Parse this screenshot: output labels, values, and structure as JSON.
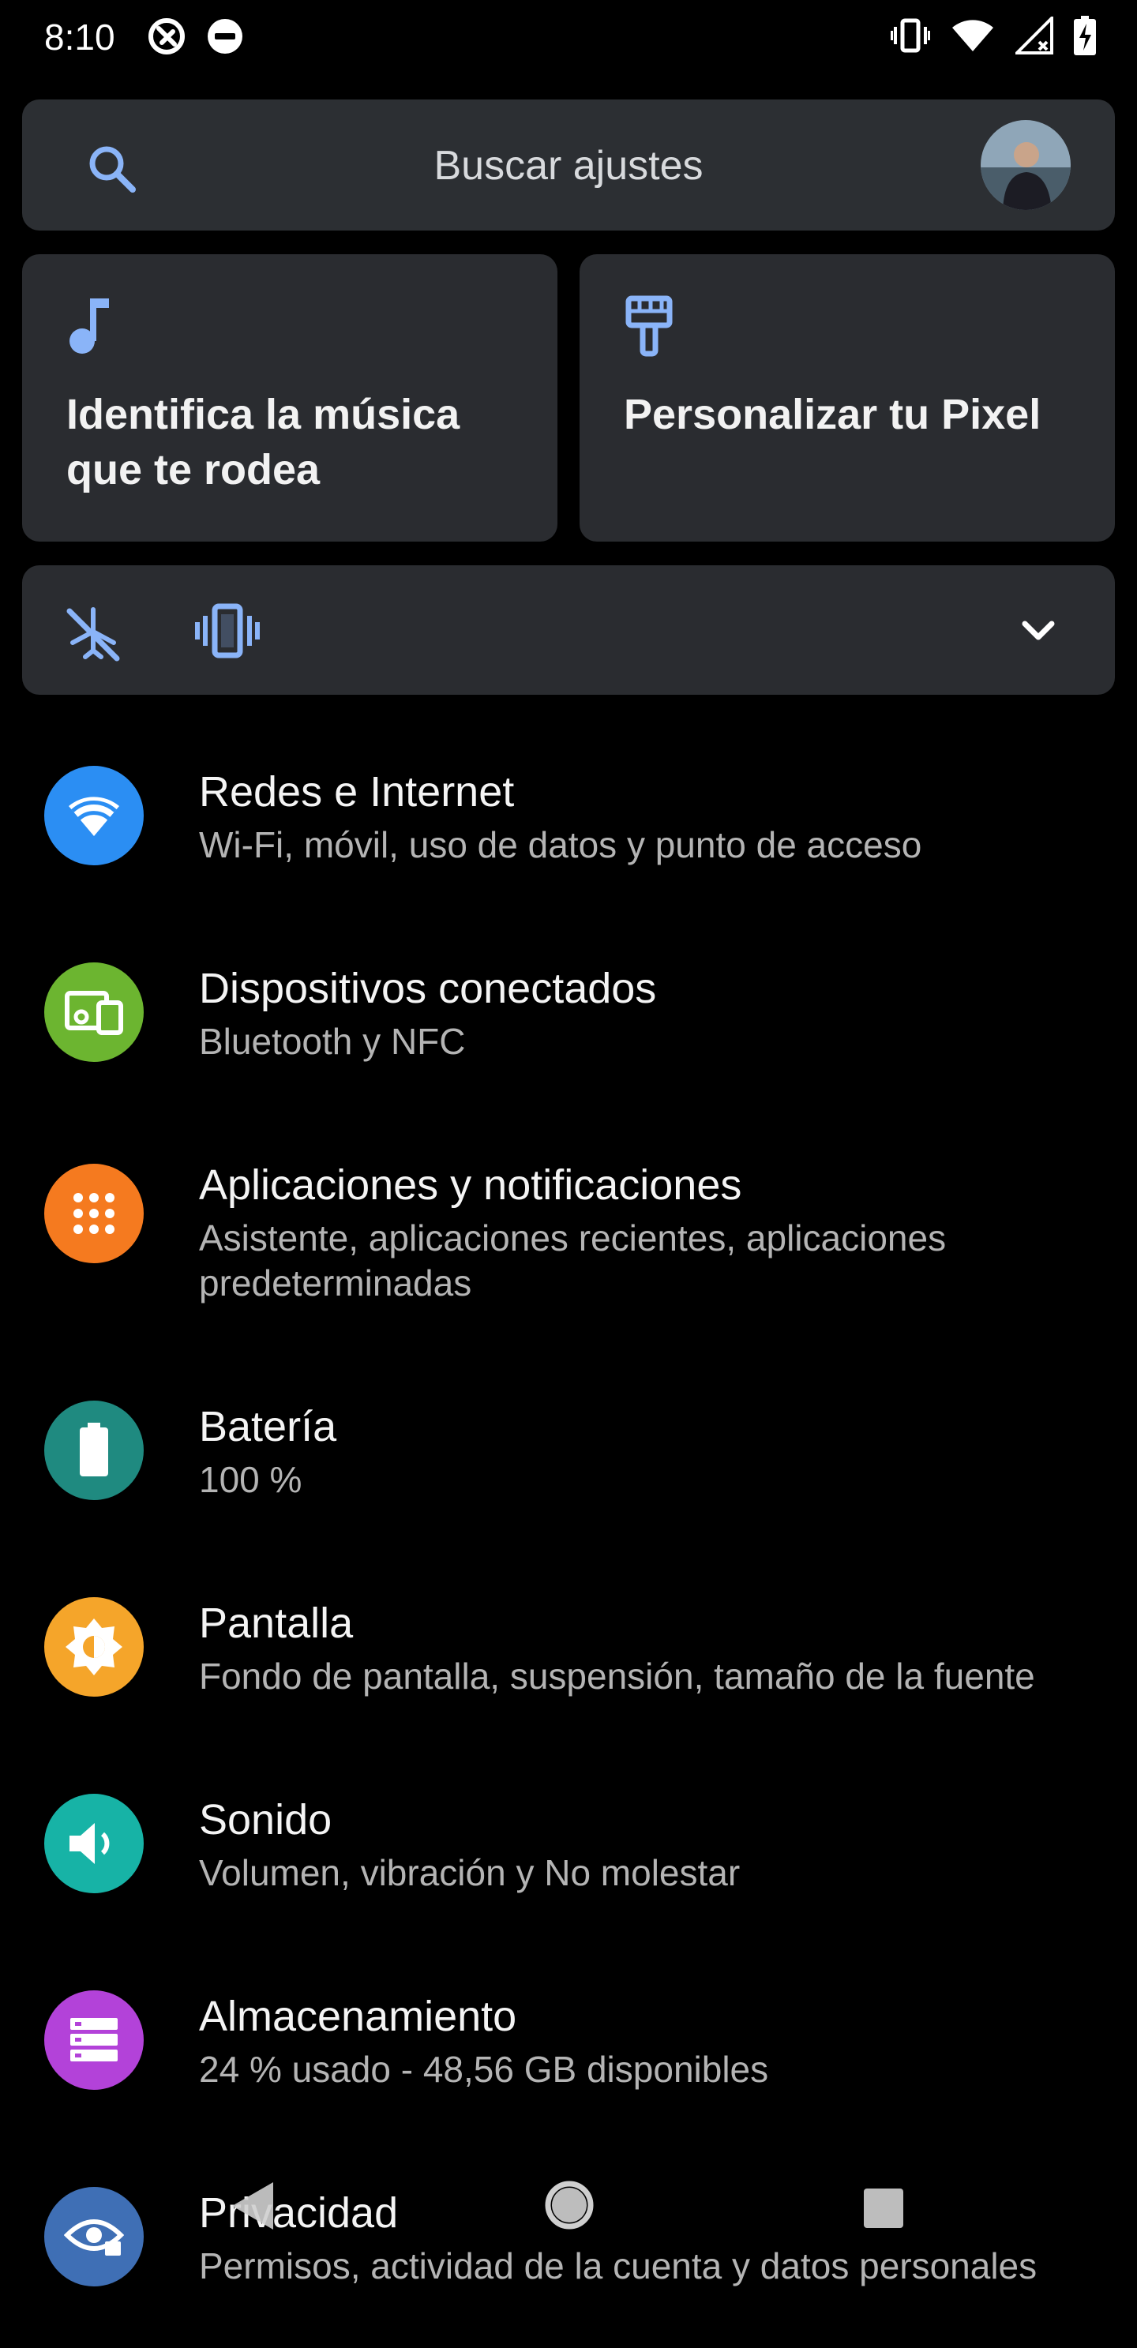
{
  "status_bar": {
    "time": "8:10"
  },
  "search": {
    "placeholder": "Buscar ajustes"
  },
  "suggestions": [
    {
      "text": "Identifica la música que te rodea",
      "icon": "music-note-icon"
    },
    {
      "text": "Personalizar tu Pixel",
      "icon": "paint-brush-icon"
    }
  ],
  "conditionals": {
    "icons": [
      "airplane-off-icon",
      "vibrate-icon"
    ],
    "expand_icon": "chevron-down-icon"
  },
  "settings": [
    {
      "title": "Redes e Internet",
      "subtitle": "Wi-Fi, móvil, uso de datos y punto de acceso",
      "icon": "wifi-icon",
      "color": "#2b8ef3"
    },
    {
      "title": "Dispositivos conectados",
      "subtitle": "Bluetooth y NFC",
      "icon": "devices-icon",
      "color": "#6cb530"
    },
    {
      "title": "Aplicaciones y notificaciones",
      "subtitle": "Asistente, aplicaciones recientes, aplicaciones predeterminadas",
      "icon": "apps-icon",
      "color": "#f57a1f"
    },
    {
      "title": "Batería",
      "subtitle": "100 %",
      "icon": "battery-icon",
      "color": "#1f8a80"
    },
    {
      "title": "Pantalla",
      "subtitle": "Fondo de pantalla, suspensión, tamaño de la fuente",
      "icon": "display-icon",
      "color": "#f5a52a"
    },
    {
      "title": "Sonido",
      "subtitle": "Volumen, vibración y No molestar",
      "icon": "sound-icon",
      "color": "#17b3a6"
    },
    {
      "title": "Almacenamiento",
      "subtitle": "24 % usado - 48,56 GB disponibles",
      "icon": "storage-icon",
      "color": "#b342d9"
    },
    {
      "title": "Privacidad",
      "subtitle": "Permisos, actividad de la cuenta y datos personales",
      "icon": "privacy-icon",
      "color": "#3f6fb5"
    }
  ]
}
